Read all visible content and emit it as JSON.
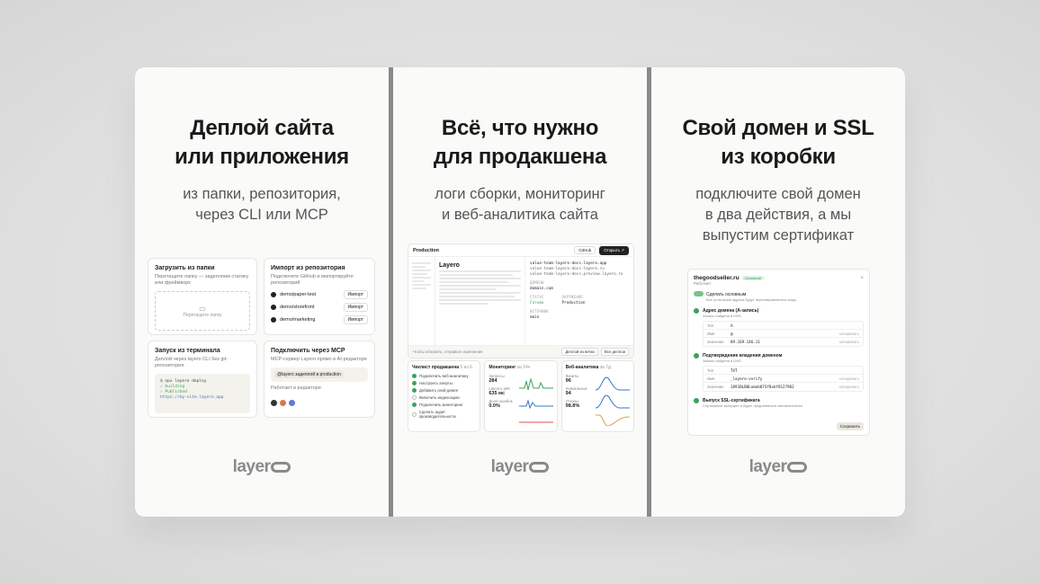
{
  "panels": [
    {
      "title": [
        "Деплой сайта",
        "или приложения"
      ],
      "subtitle": [
        "из папки, репозитория,",
        "через CLI или MCP"
      ],
      "logo": "layer",
      "cards": {
        "upload": {
          "title": "Загрузить из папки",
          "desc": "Перетащите папку — задеплоим статику или фреймворк",
          "drop": "Перетащите папку"
        },
        "import": {
          "title": "Импорт из репозитория",
          "desc": "Подключите GitHub и импортируйте репозиторий",
          "repos": [
            {
              "name": "demo/paper-test",
              "btn": "Импорт"
            },
            {
              "name": "demo/storefront",
              "btn": "Импорт"
            },
            {
              "name": "demo/marketing",
              "btn": "Импорт"
            }
          ]
        },
        "terminal": {
          "title": "Запуск из терминала",
          "desc": "Деплой через layero CLI без git-репозитория",
          "lines": [
            "$ npx layero deploy",
            "✓ building",
            "✓ Published",
            "https://my-site.layero.app"
          ]
        },
        "mcp": {
          "title": "Подключить через MCP",
          "desc": "MCP-сервер Layero прямо в AI-редакторе",
          "chip": "@layero задеплой в production",
          "hint": "Работает в редакторе"
        }
      }
    },
    {
      "title": [
        "Всё, что нужно",
        "для продакшена"
      ],
      "subtitle": [
        "логи сборки, мониторинг",
        "и веб-аналитика сайта"
      ],
      "logo": "layer",
      "mock": {
        "header": "Production",
        "btn_github": "GitHub",
        "btn_open": "Открыть ↗",
        "app_name": "Layero",
        "urls": [
          "value-team-layero-docs.layero.app",
          "value-team-layero-docs-layero.ru",
          "value-team-layero-docs.preview.layero.ru"
        ],
        "domain_label": "ДОМЕНЫ",
        "domain": "domain.com",
        "status_label": "СТАТУС",
        "status": "Готово",
        "env_label": "ОКРУЖЕНИЕ",
        "env": "Production",
        "source_label": "ИСТОЧНИК",
        "branch": "main",
        "footer_text": "Чтобы обновить, отправьте изменения",
        "btn_deploy": "Деплой из ветки",
        "btn_all": "Все деплои",
        "checklist": {
          "title": "Чеклист продакшена",
          "count": "5 из 6",
          "items": [
            {
              "text": "Подключить веб-аналитику",
              "done": true
            },
            {
              "text": "Настроить алерты",
              "done": true
            },
            {
              "text": "Добавить свой домен",
              "done": true
            },
            {
              "text": "Включить индексацию",
              "done": false
            },
            {
              "text": "Подключить мониторинг",
              "done": true
            },
            {
              "text": "Сделать аудит производительности",
              "done": false
            }
          ]
        },
        "monitoring": {
          "title": "Мониторинг",
          "period": "за 24ч",
          "metrics": [
            {
              "label": "Запросы",
              "value": "284"
            },
            {
              "label": "Latency p95",
              "value": "635 мс"
            },
            {
              "label": "Доля ошибок",
              "value": "0.0%"
            }
          ]
        },
        "analytics": {
          "title": "Веб-аналитика",
          "period": "за 7д",
          "metrics": [
            {
              "label": "Визиты",
              "value": "96"
            },
            {
              "label": "Уникальные",
              "value": "94"
            },
            {
              "label": "Отказы",
              "value": "98.8%"
            }
          ]
        }
      }
    },
    {
      "title": [
        "Свой домен и SSL",
        "из коробки"
      ],
      "subtitle": [
        "подключите свой домен",
        "в два действия, а мы",
        "выпустим сертификат"
      ],
      "logo": "layer",
      "mock": {
        "domain": "thegoodseller.ru",
        "badge": "Основной",
        "status": "Работает",
        "toggle_label": "Сделать основным",
        "toggle_desc": "Все остальные адреса будут перенаправляться сюда",
        "steps": [
          {
            "title": "Адрес домена (A-запись)",
            "desc": "Запись найдена в DNS",
            "rows": [
              {
                "k": "Тип",
                "v": "A",
                "c": ""
              },
              {
                "k": "Имя",
                "v": "@",
                "c": "копировать"
              },
              {
                "k": "Значение",
                "v": "89.169.146.11",
                "c": "копировать"
              }
            ]
          },
          {
            "title": "Подтверждение владения доменом",
            "desc": "Запись найдена в DNS",
            "rows": [
              {
                "k": "Тип",
                "v": "TXT",
                "c": ""
              },
              {
                "k": "Имя",
                "v": "_layero-verify",
                "c": "копировать"
              },
              {
                "k": "Значение",
                "v": "1891BLB0Lomob87Sf8xbf8127982",
                "c": "копировать"
              }
            ]
          },
          {
            "title": "Выпуск SSL-сертификата",
            "desc": "Сертификат выпущен и будет продлеваться автоматически",
            "rows": []
          }
        ],
        "save": "Сохранить"
      }
    }
  ]
}
